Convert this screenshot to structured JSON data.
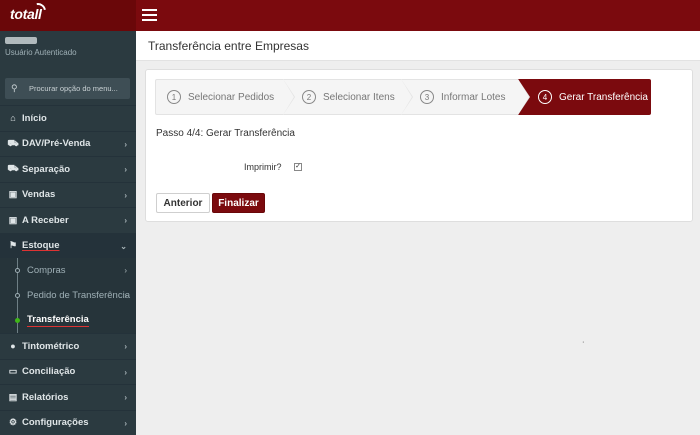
{
  "app": {
    "logo_text": "totall",
    "colors": {
      "brand": "#7b0a0e",
      "sidebar": "#2b3a40"
    }
  },
  "user": {
    "role": "Usuário Autenticado"
  },
  "search": {
    "placeholder": "Procurar opção do menu..."
  },
  "sidebar": {
    "items": [
      {
        "label": "Início",
        "icon": "home-icon"
      },
      {
        "label": "DAV/Pré-Venda",
        "icon": "truck-icon"
      },
      {
        "label": "Separação",
        "icon": "truck-icon"
      },
      {
        "label": "Vendas",
        "icon": "bag-icon"
      },
      {
        "label": "A Receber",
        "icon": "bag-icon"
      },
      {
        "label": "Estoque",
        "icon": "tag-icon"
      },
      {
        "label": "Tintométrico",
        "icon": "droplet-icon"
      },
      {
        "label": "Conciliação",
        "icon": "card-icon"
      },
      {
        "label": "Relatórios",
        "icon": "chart-icon"
      },
      {
        "label": "Configurações",
        "icon": "gears-icon"
      }
    ],
    "estoque_sub": [
      {
        "label": "Compras"
      },
      {
        "label": "Pedido de Transferência"
      },
      {
        "label": "Transferência"
      }
    ]
  },
  "page": {
    "title": "Transferência entre Empresas"
  },
  "wizard": {
    "steps": [
      {
        "num": "1",
        "label": "Selecionar Pedidos"
      },
      {
        "num": "2",
        "label": "Selecionar Itens"
      },
      {
        "num": "3",
        "label": "Informar Lotes"
      },
      {
        "num": "4",
        "label": "Gerar Transferência"
      }
    ],
    "caption": "Passo 4/4: Gerar Transferência",
    "print_label": "Imprimir?",
    "print_checked": true,
    "prev_label": "Anterior",
    "finish_label": "Finalizar"
  }
}
